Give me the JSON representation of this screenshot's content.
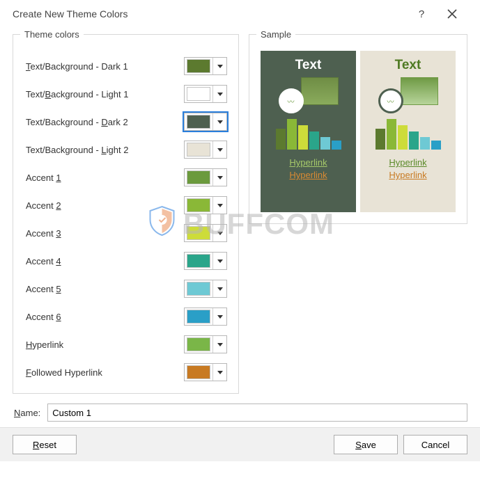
{
  "dialog": {
    "title": "Create New Theme Colors",
    "help_tooltip": "?",
    "close_tooltip": "Close"
  },
  "groups": {
    "theme_colors": "Theme colors",
    "sample": "Sample"
  },
  "rows": [
    {
      "label_pre": "",
      "label_u": "T",
      "label_post": "ext/Background - Dark 1",
      "color": "#5c7a2f",
      "selected": false
    },
    {
      "label_pre": "Text/",
      "label_u": "B",
      "label_post": "ackground - Light 1",
      "color": "#ffffff",
      "selected": false
    },
    {
      "label_pre": "Text/Background - ",
      "label_u": "D",
      "label_post": "ark 2",
      "color": "#4e6050",
      "selected": true
    },
    {
      "label_pre": "Text/Background - ",
      "label_u": "L",
      "label_post": "ight 2",
      "color": "#e8e3d6",
      "selected": false
    },
    {
      "label_pre": "Accent ",
      "label_u": "1",
      "label_post": "",
      "color": "#6b9a3d",
      "selected": false
    },
    {
      "label_pre": "Accent ",
      "label_u": "2",
      "label_post": "",
      "color": "#8ab837",
      "selected": false
    },
    {
      "label_pre": "Accent ",
      "label_u": "3",
      "label_post": "",
      "color": "#cddc3a",
      "selected": false
    },
    {
      "label_pre": "Accent ",
      "label_u": "4",
      "label_post": "",
      "color": "#2aa58a",
      "selected": false
    },
    {
      "label_pre": "Accent ",
      "label_u": "5",
      "label_post": "",
      "color": "#6ec9d4",
      "selected": false
    },
    {
      "label_pre": "Accent ",
      "label_u": "6",
      "label_post": "",
      "color": "#2a9fc7",
      "selected": false
    },
    {
      "label_pre": "",
      "label_u": "H",
      "label_post": "yperlink",
      "color": "#7ab648",
      "selected": false
    },
    {
      "label_pre": "",
      "label_u": "F",
      "label_post": "ollowed Hyperlink",
      "color": "#c87a22",
      "selected": false
    }
  ],
  "sample": {
    "text_label": "Text",
    "hyperlink_label": "Hyperlink",
    "followed_label": "Hyperlink"
  },
  "name": {
    "label_u": "N",
    "label_post": "ame:",
    "value": "Custom 1"
  },
  "buttons": {
    "reset_u": "R",
    "reset_post": "eset",
    "save_u": "S",
    "save_post": "ave",
    "cancel": "Cancel"
  },
  "watermark": {
    "text": "Buffcom"
  }
}
